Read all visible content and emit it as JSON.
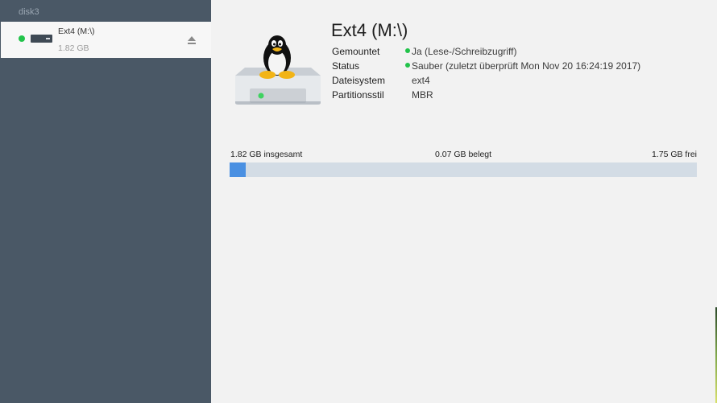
{
  "sidebar": {
    "disk_label": "disk3",
    "volume": {
      "name": "Ext4 (M:\\)",
      "size": "1.82 GB",
      "mounted_indicator_color": "#22c34a",
      "icon": "hard-drive-icon",
      "eject_icon": "eject-icon"
    }
  },
  "main": {
    "title": "Ext4 (M:\\)",
    "illustration": "linux-drive-icon",
    "properties": {
      "mounted_label": "Gemountet",
      "mounted_value": "Ja (Lese-/Schreibzugriff)",
      "status_label": "Status",
      "status_value": "Sauber (zuletzt überprüft Mon Nov 20 16:24:19 2017)",
      "filesystem_label": "Dateisystem",
      "filesystem_value": "ext4",
      "partition_style_label": "Partitionsstil",
      "partition_style_value": "MBR"
    },
    "usage": {
      "total_text": "1.82 GB insgesamt",
      "used_text": "0.07 GB belegt",
      "free_text": "1.75 GB frei",
      "used_fraction": 0.035,
      "fill_color": "#4a90e2",
      "track_color": "#d3dce5"
    }
  }
}
